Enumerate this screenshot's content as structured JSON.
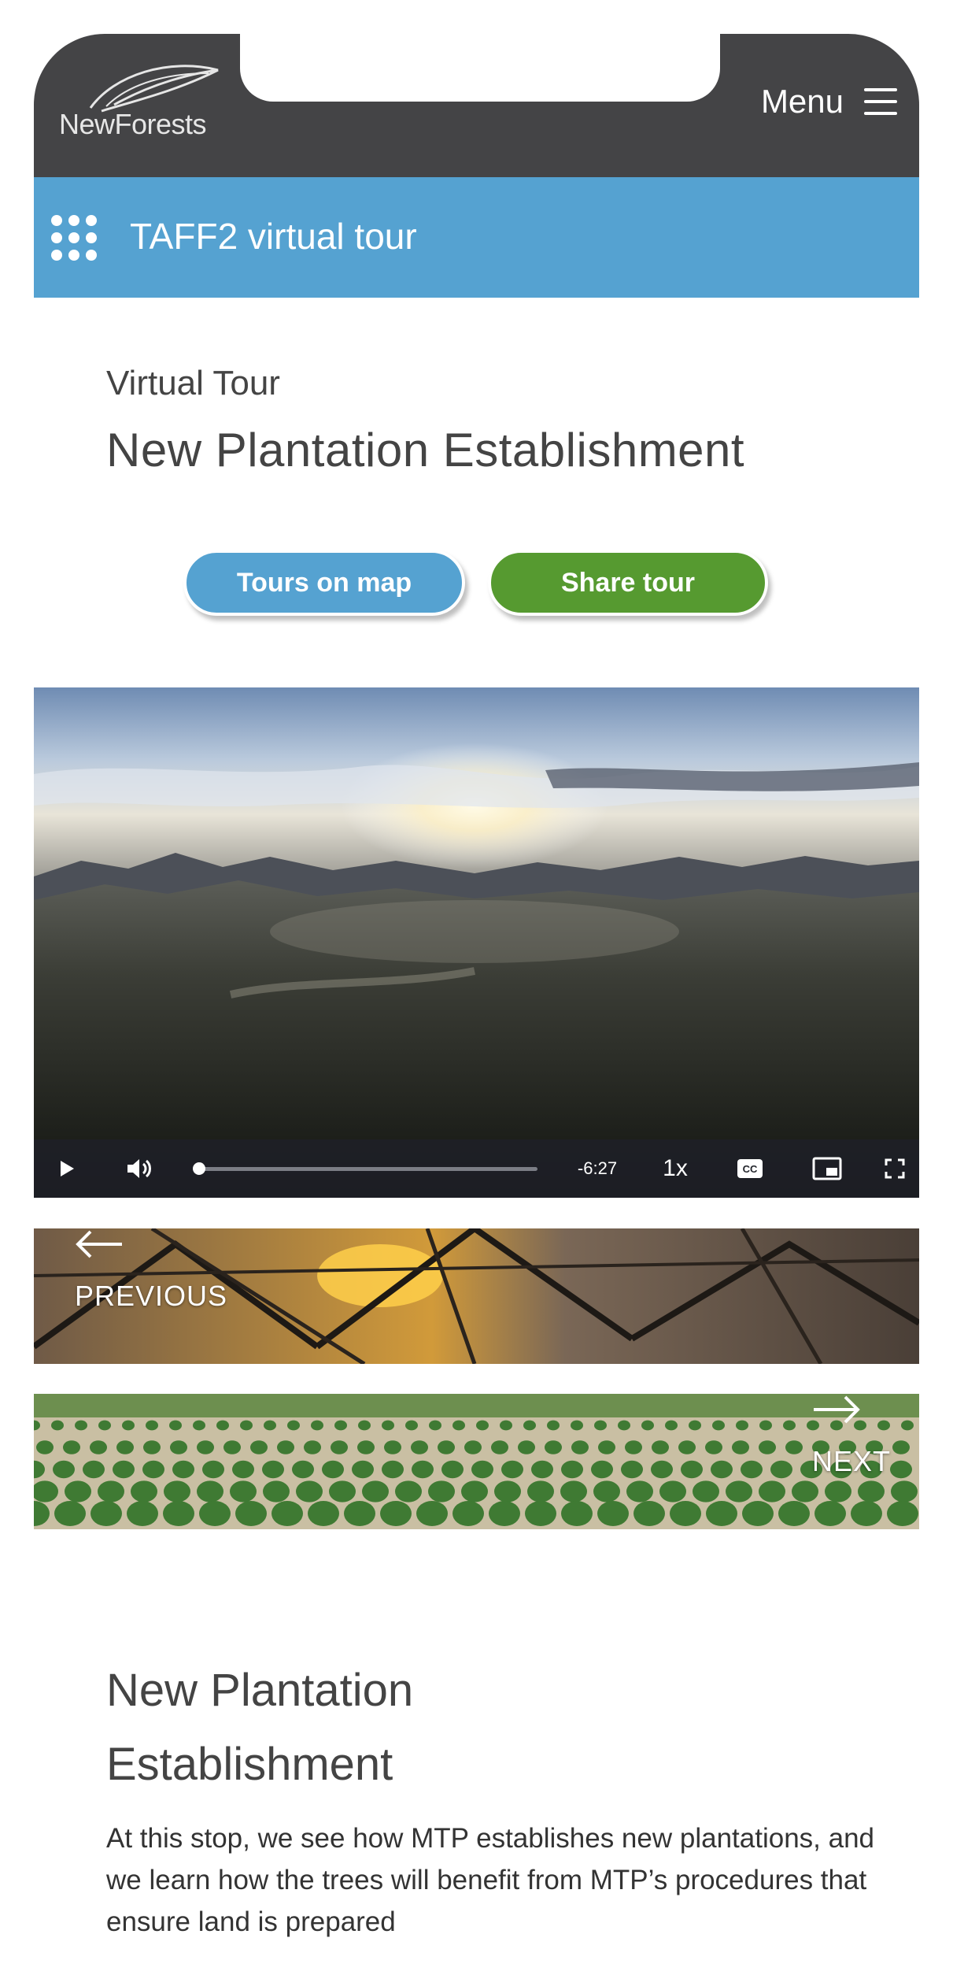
{
  "header": {
    "logo_text": "NewForests",
    "menu_label": "Menu"
  },
  "tour_bar": {
    "title": "TAFF2 virtual tour"
  },
  "heading": {
    "eyebrow": "Virtual Tour",
    "title": "New Plantation Establishment"
  },
  "actions": {
    "map_label": "Tours on map",
    "share_label": "Share tour"
  },
  "video": {
    "time_remaining": "-6:27",
    "playback_speed": "1x",
    "progress_fraction": 0.0,
    "icons": [
      "play-icon",
      "volume-icon",
      "captions-icon",
      "picture-in-picture-icon",
      "fullscreen-icon"
    ]
  },
  "navigation": {
    "previous_label": "PREVIOUS",
    "next_label": "NEXT"
  },
  "content": {
    "section_title": "New Plantation Establishment",
    "section_text": "At this stop, we see how MTP establishes new plantations, and we learn how the trees will benefit from MTP’s procedures that ensure land is prepared"
  },
  "colors": {
    "header_bg": "#444446",
    "tour_bar_bg": "#55a2d1",
    "map_button": "#55a2d1",
    "share_button": "#569a30"
  }
}
